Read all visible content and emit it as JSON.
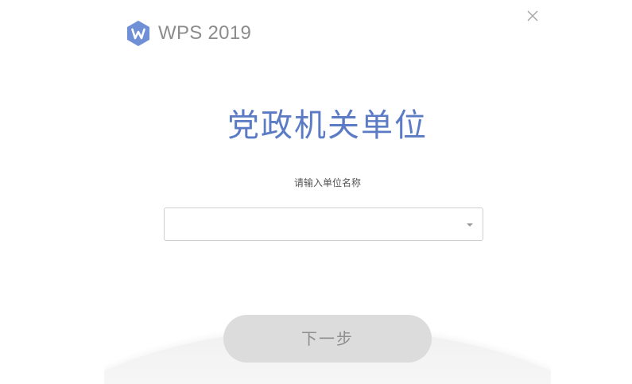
{
  "app": {
    "logo_text": "WPS 2019",
    "logo_icon": "wps-logo-icon",
    "close_icon": "close-icon"
  },
  "main": {
    "heading": "党政机关单位",
    "prompt_label": "请输入单位名称",
    "unit_select": {
      "value": "",
      "caret_icon": "caret-down-icon"
    },
    "next_button": "下一步"
  },
  "colors": {
    "accent": "#5b7cc4",
    "logo_blue": "#6f8fd6",
    "button_disabled_bg": "#dcdcdc",
    "button_disabled_text": "#8e8e8e"
  }
}
